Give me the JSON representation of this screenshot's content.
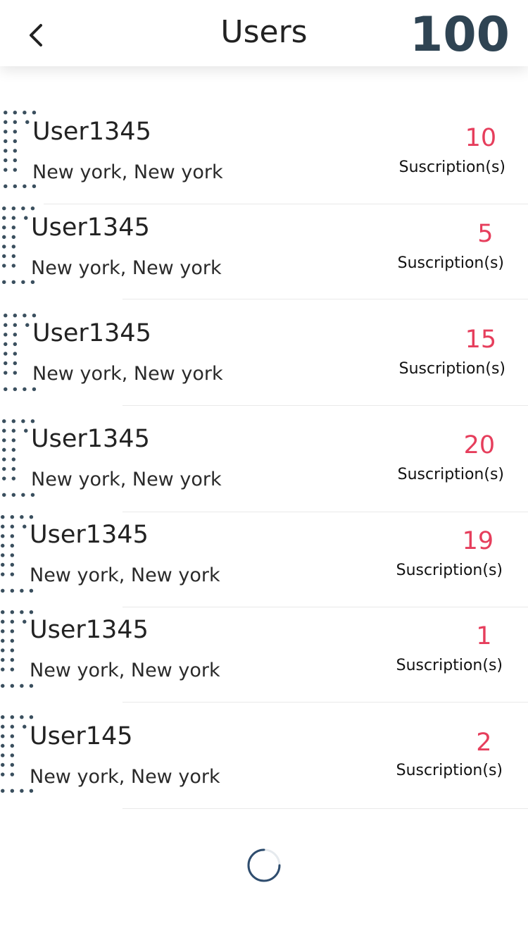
{
  "header": {
    "title": "Users",
    "count": "100",
    "back_icon": "chevron-left-icon"
  },
  "users": [
    {
      "name": "User1345",
      "location": "New york, New york",
      "count": "10",
      "label": "Suscription(s)"
    },
    {
      "name": "User1345",
      "location": "New york, New york",
      "count": "5",
      "label": "Suscription(s)"
    },
    {
      "name": "User1345",
      "location": "New york, New york",
      "count": "15",
      "label": "Suscription(s)"
    },
    {
      "name": "User1345",
      "location": "New york, New york",
      "count": "20",
      "label": "Suscription(s)"
    },
    {
      "name": "User1345",
      "location": "New york, New york",
      "count": "19",
      "label": "Suscription(s)"
    },
    {
      "name": "User1345",
      "location": "New york, New york",
      "count": "1",
      "label": "Suscription(s)"
    },
    {
      "name": "User145",
      "location": "New york, New york",
      "count": "2",
      "label": "Suscription(s)"
    }
  ],
  "colors": {
    "accent": "#e63e5c",
    "header_count": "#2f4453",
    "dots": "#3a4f5e"
  },
  "loading_icon": "spinner-icon"
}
